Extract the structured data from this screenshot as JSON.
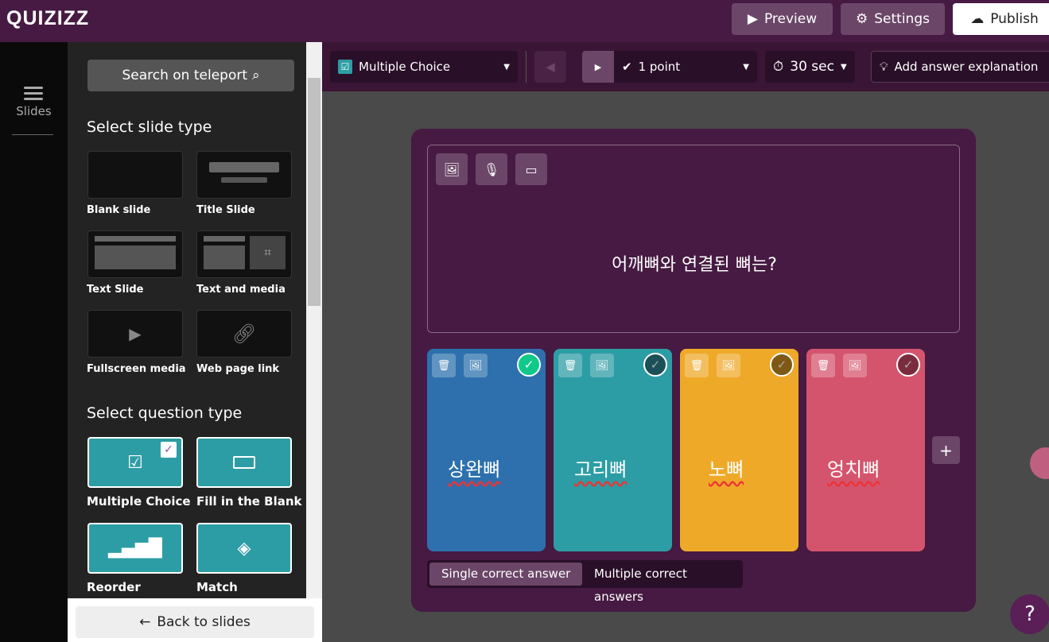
{
  "header": {
    "logo": "QUIZIZZ",
    "preview": "Preview",
    "settings": "Settings",
    "publish": "Publish"
  },
  "rail": {
    "slides": "Slides"
  },
  "panel": {
    "search": "Search on teleport",
    "slide_type_title": "Select slide type",
    "slide_types": [
      "Blank slide",
      "Title Slide",
      "Text Slide",
      "Text and media",
      "Fullscreen media",
      "Web page link"
    ],
    "question_type_title": "Select question type",
    "question_types": [
      "Multiple Choice",
      "Fill in the Blank",
      "Reorder",
      "Match"
    ],
    "back": "Back to slides"
  },
  "toolbar": {
    "question_type": "Multiple Choice",
    "points": "1 point",
    "time": "30 sec",
    "explanation": "Add answer explanation"
  },
  "question": {
    "text": "어깨뼈와 연결된 뼈는?"
  },
  "answers": [
    {
      "text": "상완뼈",
      "color": "#2d70ad",
      "correct": true
    },
    {
      "text": "고리뼈",
      "color": "#2d9da5",
      "correct": false
    },
    {
      "text": "노뼈",
      "color": "#efa929",
      "correct": false
    },
    {
      "text": "엉치뼈",
      "color": "#d5546d",
      "correct": false
    }
  ],
  "answer_mode": {
    "single": "Single correct answer",
    "multiple": "Multiple correct answers",
    "selected": "single"
  },
  "help": "?"
}
